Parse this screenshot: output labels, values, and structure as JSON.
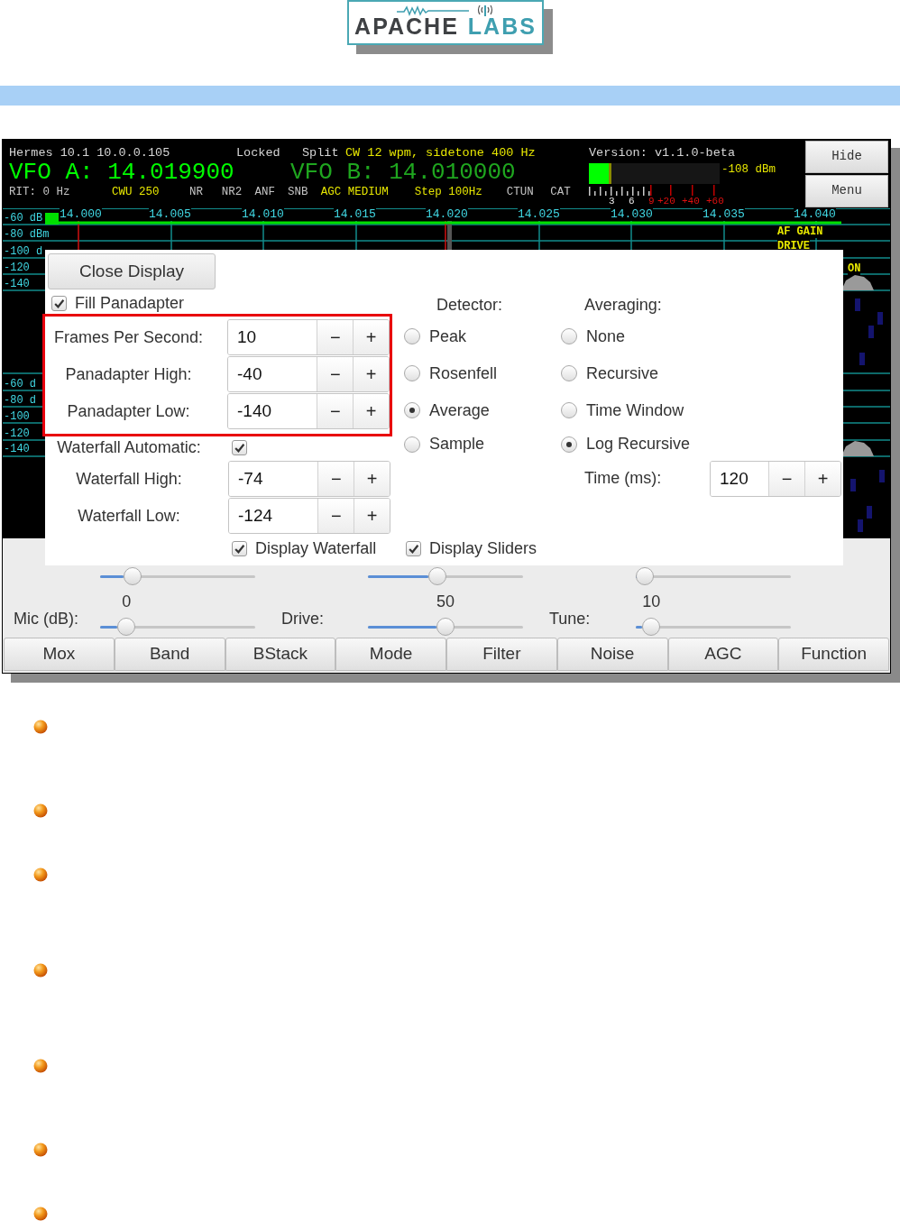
{
  "logo": {
    "word_1": "APACHE",
    "word_2": "LABS"
  },
  "radio": {
    "status_line": [
      {
        "text": "Hermes 10.1 10.0.0.105",
        "kind": "plain"
      },
      {
        "text": "Locked",
        "kind": "plain"
      },
      {
        "text": "Split",
        "kind": "plain"
      },
      {
        "text": "CW 12 wpm, sidetone 400 Hz",
        "kind": "active"
      }
    ],
    "version": "Version: v1.1.0-beta",
    "vfos": [
      {
        "text": "VFO A: 14.019900",
        "selected": true
      },
      {
        "text": "VFO B: 14.010000",
        "selected": false
      }
    ],
    "indicators": [
      {
        "label": "RIT: 0 Hz",
        "on": false
      },
      {
        "label": "CWU 250",
        "on": true
      },
      {
        "label": "NR",
        "on": false
      },
      {
        "label": "NR2",
        "on": false
      },
      {
        "label": "ANF",
        "on": false
      },
      {
        "label": "SNB",
        "on": false
      },
      {
        "label": "AGC MEDIUM",
        "on": true
      },
      {
        "label": "Step 100Hz",
        "on": true
      },
      {
        "label": "CTUN",
        "on": false
      },
      {
        "label": "CAT",
        "on": false
      }
    ],
    "s_meter": {
      "level": 0.17,
      "reading": "-108 dBm",
      "scale": [
        {
          "label": "3",
          "over": false
        },
        {
          "label": "6",
          "over": false
        },
        {
          "label": "9",
          "over": true
        },
        {
          "label": "+20",
          "over": true
        },
        {
          "label": "+40",
          "over": true
        },
        {
          "label": "+60",
          "over": true
        }
      ]
    },
    "side_buttons": [
      "Hide",
      "Menu"
    ],
    "frequency_labels": [
      "14.000",
      "14.005",
      "14.010",
      "14.015",
      "14.020",
      "14.025",
      "14.030",
      "14.035",
      "14.040"
    ],
    "panadapters": [
      {
        "db_labels": [
          "-60 dB",
          "-80 dBm",
          "-100 d",
          "-120",
          "-140"
        ]
      },
      {
        "db_labels": [
          "-60 d",
          "-80 d",
          "-100",
          "-120",
          "-140"
        ]
      }
    ],
    "overlay_labels": [
      "AF GAIN",
      "DRIVE",
      "ON"
    ],
    "sliders": [
      {
        "level": 0.21
      },
      {
        "level": 0.45
      },
      {
        "level": 0.06
      },
      {
        "label": "Mic (dB):",
        "value": "0",
        "level": 0.17
      },
      {
        "label": "Drive:",
        "value": "50",
        "level": 0.5
      },
      {
        "label": "Tune:",
        "value": "10",
        "level": 0.1
      }
    ],
    "buttons": [
      "Mox",
      "Band",
      "BStack",
      "Mode",
      "Filter",
      "Noise",
      "AGC",
      "Function"
    ]
  },
  "display_dialog": {
    "close_button": "Close Display",
    "fill_panadapter": {
      "label": "Fill Panadapter",
      "checked": true
    },
    "highlighted_fields": [
      {
        "label": "Frames Per Second:",
        "value": "10",
        "decrement": "−",
        "increment": "+"
      },
      {
        "label": "Panadapter High:",
        "value": "-40",
        "decrement": "−",
        "increment": "+"
      },
      {
        "label": "Panadapter Low:",
        "value": "-140",
        "decrement": "−",
        "increment": "+"
      }
    ],
    "waterfall_automatic": {
      "label": "Waterfall Automatic:",
      "checked": true
    },
    "waterfall_fields": [
      {
        "label": "Waterfall High:",
        "value": "-74",
        "decrement": "−",
        "increment": "+"
      },
      {
        "label": "Waterfall Low:",
        "value": "-124",
        "decrement": "−",
        "increment": "+"
      }
    ],
    "detector": {
      "title": "Detector:",
      "options": [
        {
          "label": "Peak",
          "selected": false
        },
        {
          "label": "Rosenfell",
          "selected": false
        },
        {
          "label": "Average",
          "selected": true
        },
        {
          "label": "Sample",
          "selected": false
        }
      ]
    },
    "averaging": {
      "title": "Averaging:",
      "options": [
        {
          "label": "None",
          "selected": false
        },
        {
          "label": "Recursive",
          "selected": false
        },
        {
          "label": "Time Window",
          "selected": false
        },
        {
          "label": "Log Recursive",
          "selected": true
        }
      ],
      "time": {
        "label": "Time (ms):",
        "value": "120",
        "decrement": "−",
        "increment": "+"
      }
    },
    "display_waterfall": {
      "label": "Display Waterfall",
      "checked": true
    },
    "display_sliders": {
      "label": "Display Sliders",
      "checked": true
    }
  },
  "bullets": [
    {
      "kind": "orb"
    },
    {
      "kind": "orb"
    },
    {
      "kind": "orb"
    },
    {
      "kind": "orb"
    },
    {
      "kind": "orb"
    },
    {
      "kind": "orb"
    },
    {
      "kind": "orb"
    }
  ]
}
